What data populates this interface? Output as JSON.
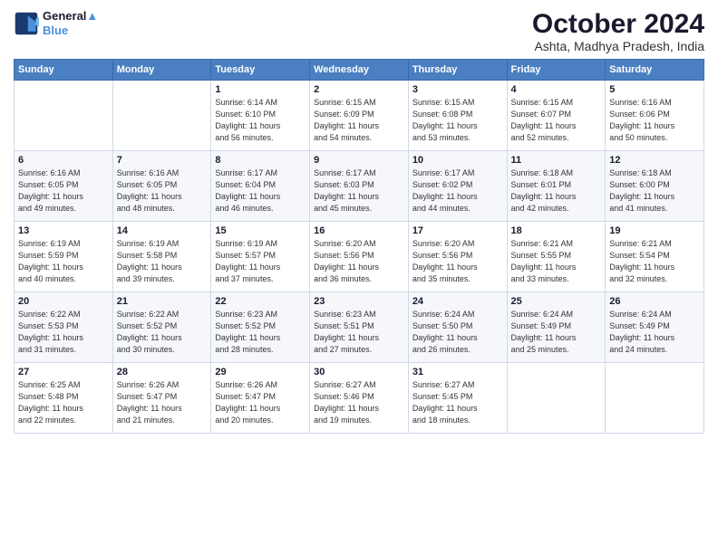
{
  "header": {
    "logo_line1": "General",
    "logo_line2": "Blue",
    "month": "October 2024",
    "location": "Ashta, Madhya Pradesh, India"
  },
  "weekdays": [
    "Sunday",
    "Monday",
    "Tuesday",
    "Wednesday",
    "Thursday",
    "Friday",
    "Saturday"
  ],
  "weeks": [
    [
      {
        "day": "",
        "info": ""
      },
      {
        "day": "",
        "info": ""
      },
      {
        "day": "1",
        "info": "Sunrise: 6:14 AM\nSunset: 6:10 PM\nDaylight: 11 hours\nand 56 minutes."
      },
      {
        "day": "2",
        "info": "Sunrise: 6:15 AM\nSunset: 6:09 PM\nDaylight: 11 hours\nand 54 minutes."
      },
      {
        "day": "3",
        "info": "Sunrise: 6:15 AM\nSunset: 6:08 PM\nDaylight: 11 hours\nand 53 minutes."
      },
      {
        "day": "4",
        "info": "Sunrise: 6:15 AM\nSunset: 6:07 PM\nDaylight: 11 hours\nand 52 minutes."
      },
      {
        "day": "5",
        "info": "Sunrise: 6:16 AM\nSunset: 6:06 PM\nDaylight: 11 hours\nand 50 minutes."
      }
    ],
    [
      {
        "day": "6",
        "info": "Sunrise: 6:16 AM\nSunset: 6:05 PM\nDaylight: 11 hours\nand 49 minutes."
      },
      {
        "day": "7",
        "info": "Sunrise: 6:16 AM\nSunset: 6:05 PM\nDaylight: 11 hours\nand 48 minutes."
      },
      {
        "day": "8",
        "info": "Sunrise: 6:17 AM\nSunset: 6:04 PM\nDaylight: 11 hours\nand 46 minutes."
      },
      {
        "day": "9",
        "info": "Sunrise: 6:17 AM\nSunset: 6:03 PM\nDaylight: 11 hours\nand 45 minutes."
      },
      {
        "day": "10",
        "info": "Sunrise: 6:17 AM\nSunset: 6:02 PM\nDaylight: 11 hours\nand 44 minutes."
      },
      {
        "day": "11",
        "info": "Sunrise: 6:18 AM\nSunset: 6:01 PM\nDaylight: 11 hours\nand 42 minutes."
      },
      {
        "day": "12",
        "info": "Sunrise: 6:18 AM\nSunset: 6:00 PM\nDaylight: 11 hours\nand 41 minutes."
      }
    ],
    [
      {
        "day": "13",
        "info": "Sunrise: 6:19 AM\nSunset: 5:59 PM\nDaylight: 11 hours\nand 40 minutes."
      },
      {
        "day": "14",
        "info": "Sunrise: 6:19 AM\nSunset: 5:58 PM\nDaylight: 11 hours\nand 39 minutes."
      },
      {
        "day": "15",
        "info": "Sunrise: 6:19 AM\nSunset: 5:57 PM\nDaylight: 11 hours\nand 37 minutes."
      },
      {
        "day": "16",
        "info": "Sunrise: 6:20 AM\nSunset: 5:56 PM\nDaylight: 11 hours\nand 36 minutes."
      },
      {
        "day": "17",
        "info": "Sunrise: 6:20 AM\nSunset: 5:56 PM\nDaylight: 11 hours\nand 35 minutes."
      },
      {
        "day": "18",
        "info": "Sunrise: 6:21 AM\nSunset: 5:55 PM\nDaylight: 11 hours\nand 33 minutes."
      },
      {
        "day": "19",
        "info": "Sunrise: 6:21 AM\nSunset: 5:54 PM\nDaylight: 11 hours\nand 32 minutes."
      }
    ],
    [
      {
        "day": "20",
        "info": "Sunrise: 6:22 AM\nSunset: 5:53 PM\nDaylight: 11 hours\nand 31 minutes."
      },
      {
        "day": "21",
        "info": "Sunrise: 6:22 AM\nSunset: 5:52 PM\nDaylight: 11 hours\nand 30 minutes."
      },
      {
        "day": "22",
        "info": "Sunrise: 6:23 AM\nSunset: 5:52 PM\nDaylight: 11 hours\nand 28 minutes."
      },
      {
        "day": "23",
        "info": "Sunrise: 6:23 AM\nSunset: 5:51 PM\nDaylight: 11 hours\nand 27 minutes."
      },
      {
        "day": "24",
        "info": "Sunrise: 6:24 AM\nSunset: 5:50 PM\nDaylight: 11 hours\nand 26 minutes."
      },
      {
        "day": "25",
        "info": "Sunrise: 6:24 AM\nSunset: 5:49 PM\nDaylight: 11 hours\nand 25 minutes."
      },
      {
        "day": "26",
        "info": "Sunrise: 6:24 AM\nSunset: 5:49 PM\nDaylight: 11 hours\nand 24 minutes."
      }
    ],
    [
      {
        "day": "27",
        "info": "Sunrise: 6:25 AM\nSunset: 5:48 PM\nDaylight: 11 hours\nand 22 minutes."
      },
      {
        "day": "28",
        "info": "Sunrise: 6:26 AM\nSunset: 5:47 PM\nDaylight: 11 hours\nand 21 minutes."
      },
      {
        "day": "29",
        "info": "Sunrise: 6:26 AM\nSunset: 5:47 PM\nDaylight: 11 hours\nand 20 minutes."
      },
      {
        "day": "30",
        "info": "Sunrise: 6:27 AM\nSunset: 5:46 PM\nDaylight: 11 hours\nand 19 minutes."
      },
      {
        "day": "31",
        "info": "Sunrise: 6:27 AM\nSunset: 5:45 PM\nDaylight: 11 hours\nand 18 minutes."
      },
      {
        "day": "",
        "info": ""
      },
      {
        "day": "",
        "info": ""
      }
    ]
  ]
}
